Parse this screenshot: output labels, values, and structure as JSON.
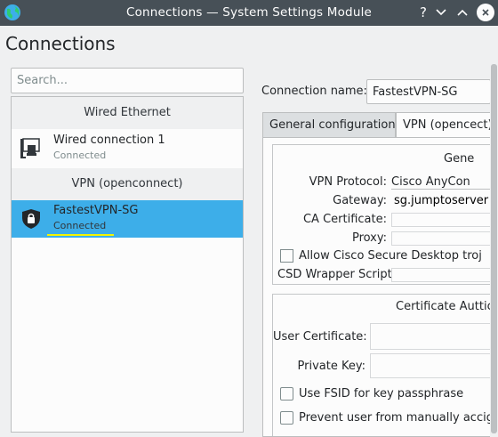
{
  "window": {
    "title": "Connections — System Settings Module",
    "help_label": "?",
    "minimize_label": "⌄",
    "maximize_label": "⌃"
  },
  "page": {
    "title": "Connections"
  },
  "search": {
    "placeholder": "Search..."
  },
  "connections": {
    "groups": [
      {
        "header": "Wired Ethernet",
        "items": [
          {
            "name": "Wired connection 1",
            "status": "Connected",
            "icon": "wired-computer-icon"
          }
        ]
      },
      {
        "header": "VPN (openconnect)",
        "items": [
          {
            "name": "FastestVPN-SG",
            "status": "Connected",
            "icon": "vpn-lock-icon",
            "selected": true
          }
        ]
      }
    ]
  },
  "details": {
    "connection_name_label": "Connection name:",
    "connection_name_value": "FastestVPN-SG",
    "tabs": [
      {
        "label": "General configuration"
      },
      {
        "label": "VPN (opencect)"
      }
    ],
    "general_group_title": "Gene",
    "fields": {
      "vpn_protocol_label": "VPN Protocol:",
      "vpn_protocol_value": "Cisco AnyCon",
      "gateway_label": "Gateway:",
      "gateway_value": "sg.jumptoserver",
      "ca_certificate_label": "CA Certificate:",
      "proxy_label": "Proxy:",
      "allow_csd_label": "Allow Cisco Secure Desktop troj",
      "csd_wrapper_label": "CSD Wrapper Script:"
    },
    "cert_group_title": "Certificate Auttic",
    "cert_fields": {
      "user_certificate_label": "User Certificate:",
      "private_key_label": "Private Key:",
      "use_fsid_label": "Use FSID for key passphrase",
      "prevent_user_label": "Prevent user from manually accig"
    }
  },
  "colors": {
    "titlebar": "#475057",
    "selection": "#3daee9",
    "highlight_underline": "#f5f500"
  }
}
